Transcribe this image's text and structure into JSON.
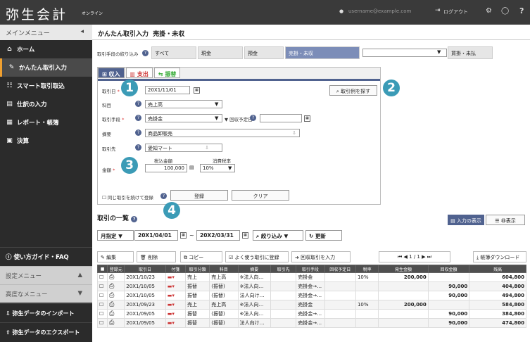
{
  "app": {
    "logo": "弥生会計",
    "logo_sub": "オンライン",
    "user_email": "username@example.com",
    "logout": "ログアウト"
  },
  "sidebar": {
    "menu_title": "メインメニュー",
    "items": [
      {
        "label": "ホーム",
        "icon": "home-icon",
        "glyph": "⌂"
      },
      {
        "label": "かんたん取引入力",
        "icon": "pencil-icon",
        "glyph": "✎"
      },
      {
        "label": "スマート取引取込",
        "icon": "import-icon",
        "glyph": "☷"
      },
      {
        "label": "仕訳の入力",
        "icon": "journal-icon",
        "glyph": "▤"
      },
      {
        "label": "レポート・帳簿",
        "icon": "report-icon",
        "glyph": "▦"
      },
      {
        "label": "決算",
        "icon": "closing-icon",
        "glyph": "▣"
      }
    ],
    "guide": "使い方ガイド・FAQ",
    "settings_menu": "設定メニュー",
    "advanced_menu": "高度なメニュー",
    "import_btn": "弥生データのインポート",
    "export_btn": "弥生データのエクスポート"
  },
  "header": {
    "title": "かんたん取引入力",
    "subtitle": "売掛・未収"
  },
  "conditions": {
    "label": "取引手段の絞り込み",
    "options": [
      "すべて",
      "現金",
      "預金",
      "売掛・未収",
      "買掛・未払"
    ]
  },
  "form": {
    "tabs": [
      "収入",
      "支出",
      "振替"
    ],
    "date_label": "取引日",
    "date_value": "20X1/11/01",
    "find_example": "取引例を探す",
    "account_label": "科目",
    "account_value": "売上高",
    "method_label": "取引手段",
    "method_value": "売掛金",
    "due_label": "回収予定日",
    "summary_label": "摘要",
    "summary_value": "商品卸販売",
    "partner_label": "取引先",
    "partner_value": "愛知マート",
    "amount_header": "税込金額",
    "tax_header": "消費税率",
    "amount_label": "金額",
    "amount_value": "100,000",
    "tax_value": "10%",
    "continue_label": "同じ取引を続けて登録",
    "register": "登録",
    "clear": "クリア"
  },
  "markers": [
    "1",
    "2",
    "3",
    "4"
  ],
  "list": {
    "title": "取引の一覧",
    "view_input": "入力の表示",
    "view_hide": "非表示",
    "period_mode": "月指定",
    "from": "20X1/04/01",
    "to": "20X2/03/31",
    "filter": "絞り込み",
    "refresh": "更新",
    "tools": [
      "編集",
      "削除",
      "コピー",
      "よく使う取引に登録",
      "回収取引を入力"
    ],
    "pager": "1 / 1",
    "download": "帳簿ダウンロード",
    "columns": [
      "登録元",
      "取引日",
      "付箋",
      "取引分類",
      "科目",
      "摘要",
      "取引先",
      "取引手段",
      "回収予定日",
      "税率",
      "発生金額",
      "回収金額",
      "残高"
    ],
    "rows": [
      {
        "date": "20X1/10/23",
        "cat": "売上",
        "acct": "売上高",
        "memo": "※法人向…",
        "partner": "",
        "method": "売掛金",
        "due": "",
        "tax": "10%",
        "amount": "200,000",
        "collect": "",
        "balance": "604,800"
      },
      {
        "date": "20X1/10/05",
        "cat": "振替",
        "acct": "(振替)",
        "memo": "※法人向…",
        "partner": "",
        "method": "売掛金→…",
        "due": "",
        "tax": "",
        "amount": "",
        "collect": "90,000",
        "balance": "404,800"
      },
      {
        "date": "20X1/10/05",
        "cat": "振替",
        "acct": "(振替)",
        "memo": "法人向け…",
        "partner": "",
        "method": "売掛金→…",
        "due": "",
        "tax": "",
        "amount": "",
        "collect": "90,000",
        "balance": "494,800"
      },
      {
        "date": "20X1/09/23",
        "cat": "売上",
        "acct": "売上高",
        "memo": "※法人向…",
        "partner": "",
        "method": "売掛金",
        "due": "",
        "tax": "10%",
        "amount": "200,000",
        "collect": "",
        "balance": "584,800"
      },
      {
        "date": "20X1/09/05",
        "cat": "振替",
        "acct": "(振替)",
        "memo": "※法人向…",
        "partner": "",
        "method": "売掛金→…",
        "due": "",
        "tax": "",
        "amount": "",
        "collect": "90,000",
        "balance": "384,800"
      },
      {
        "date": "20X1/09/05",
        "cat": "振替",
        "acct": "(振替)",
        "memo": "法人向け…",
        "partner": "",
        "method": "売掛金→…",
        "due": "",
        "tax": "",
        "amount": "",
        "collect": "90,000",
        "balance": "474,800"
      }
    ]
  }
}
